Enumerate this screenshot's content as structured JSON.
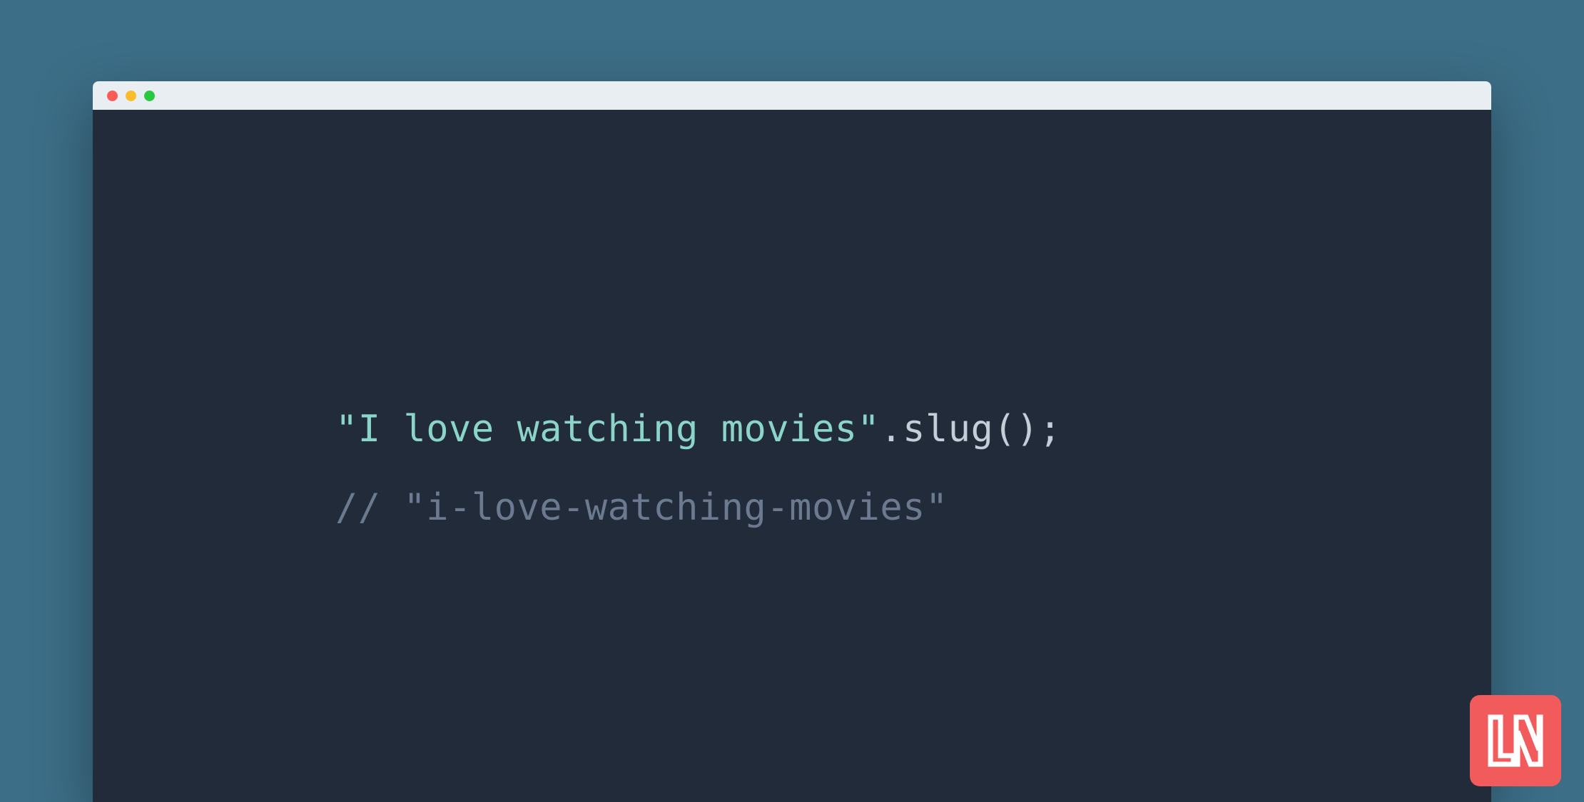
{
  "window": {
    "traffic_lights": [
      "close",
      "minimize",
      "maximize"
    ]
  },
  "code": {
    "line1": {
      "string": "\"I love watching movies\"",
      "method": ".slug();"
    },
    "line2": {
      "comment": "// \"i-love-watching-movies\""
    }
  },
  "logo": {
    "text": "LN"
  },
  "colors": {
    "background": "#3c6e87",
    "editor_bg": "#222b39",
    "titlebar_bg": "#e8eef2",
    "string": "#8bd4c9",
    "default": "#c5cdd8",
    "comment": "#6b7a90",
    "logo_bg": "#f15b5b"
  }
}
